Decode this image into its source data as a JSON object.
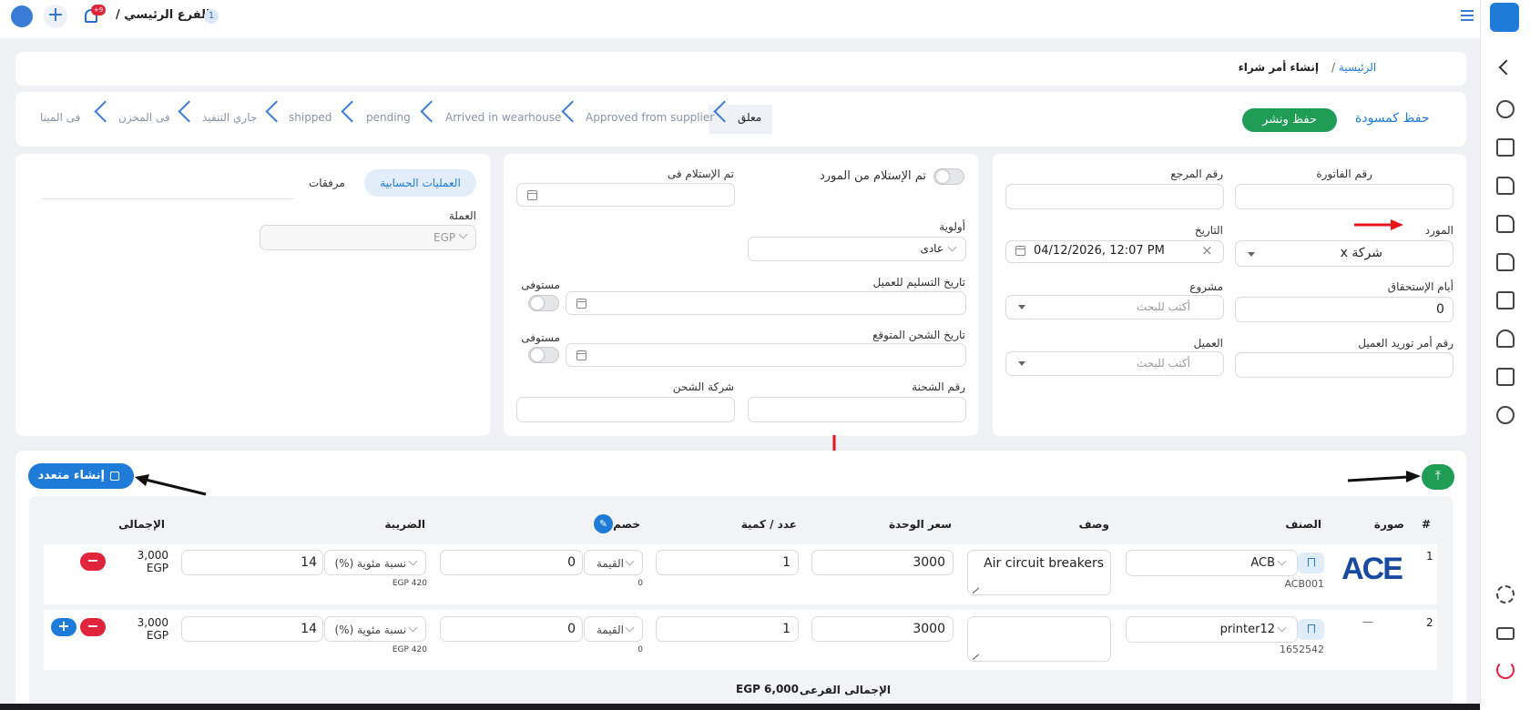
{
  "topbar": {
    "branch_label": "الفرع الرئيسي /",
    "branch_count": "1",
    "notif_count": "+9"
  },
  "breadcrumb": {
    "home": "الرئيسية",
    "sep": "/",
    "current": "إنشاء أمر شراء"
  },
  "actions": {
    "save_draft": "حفظ كمسودة",
    "save_publish": "حفظ ونشر"
  },
  "stages": [
    "معلق",
    "Approved from supplier",
    "Arrived in wearhouse",
    "pending",
    "shipped",
    "جاري التنفيذ",
    "فى المخزن",
    "فى المينا"
  ],
  "form_right": {
    "invoice_no": {
      "label": "رقم الفاتورة",
      "value": ""
    },
    "reference_no": {
      "label": "رقم المرجع",
      "value": ""
    },
    "supplier": {
      "label": "المورد",
      "value": "شركة x"
    },
    "date": {
      "label": "التاريخ",
      "value": "04/12/2026, 12:07 PM",
      "clear": "×"
    },
    "due_days": {
      "label": "أيام الإستحقاق",
      "value": "0"
    },
    "project": {
      "label": "مشروع",
      "placeholder": "أكتب للبحث"
    },
    "customer_po": {
      "label": "رقم أمر توريد العميل",
      "value": ""
    },
    "customer": {
      "label": "العميل",
      "placeholder": "أكتب للبحث"
    }
  },
  "form_middle": {
    "received_from_supplier": "تم الإستلام من المورد",
    "received_at": "تم الإستلام فى",
    "priority": {
      "label": "أولوية",
      "value": "عادى"
    },
    "delivery_date": "تاريخ التسليم للعميل",
    "fulfilled_1": "مستوفى",
    "expected_ship_date": "تاريخ الشحن المتوقع",
    "fulfilled_2": "مستوفى",
    "shipment_no": "رقم الشحنة",
    "shipping_company": "شركة الشحن"
  },
  "form_left": {
    "tab_accounting": "العمليات الحسابية",
    "tab_attachments": "مرفقات",
    "currency_label": "العملة",
    "currency_value": "EGP"
  },
  "items": {
    "bulk_create": "إنشاء متعدد",
    "headers": {
      "num": "#",
      "image": "صورة",
      "item": "الصنف",
      "desc": "وصف",
      "unit_price": "سعر الوحدة",
      "qty": "عدد / كمية",
      "discount": "خصم",
      "tax": "الضريبة",
      "total": "الإجمالى"
    },
    "rows": [
      {
        "num": "1",
        "logo": "ACE",
        "item": "ACB",
        "code": "ACB001",
        "desc": "Air circuit breakers",
        "unit_price": "3000",
        "qty": "1",
        "discount_type": "القيمة",
        "discount": "0",
        "discount_sub": "0",
        "tax_type": "نسبة مئوية (%)",
        "tax": "14",
        "tax_sub": "EGP 420",
        "total": "3,000",
        "currency": "EGP"
      },
      {
        "num": "2",
        "logo": "—",
        "item": "printer12",
        "code": "1652542",
        "desc": "",
        "unit_price": "3000",
        "qty": "1",
        "discount_type": "القيمة",
        "discount": "0",
        "discount_sub": "0",
        "tax_type": "نسبة مئوية (%)",
        "tax": "14",
        "tax_sub": "EGP 420",
        "total": "3,000",
        "currency": "EGP"
      }
    ],
    "subtotal_label": "الإجمالى الفرعى",
    "subtotal_value": "EGP 6,000"
  },
  "colors": {
    "primary": "#1e7bd8",
    "green": "#1f9d55",
    "red": "#e0243b",
    "arrow_red": "#e8141c"
  }
}
